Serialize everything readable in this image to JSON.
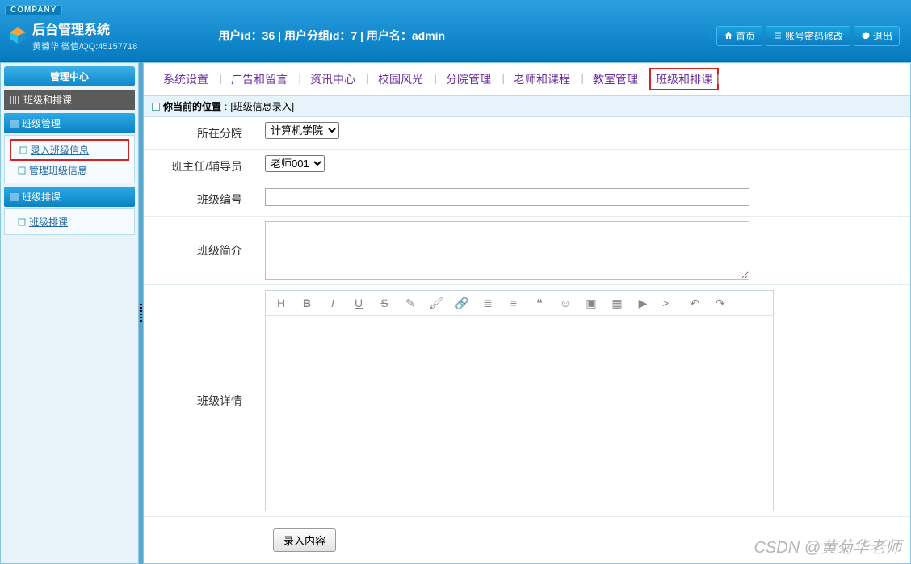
{
  "header": {
    "company_badge": "COMPANY",
    "app_title": "后台管理系统",
    "sub_title": "黄菊华 微信/QQ:45157718",
    "user_info": "用户id：36 | 用户分组id：7 | 用户名：admin",
    "btn_home": "首页",
    "btn_account": "账号密码修改",
    "btn_logout": "退出"
  },
  "left": {
    "center_header": "管理中心",
    "crumb": "班级和排课",
    "groups": [
      {
        "name": "class-mgmt",
        "title": "班级管理",
        "items": [
          {
            "name": "enter-class-info",
            "label": "录入班级信息",
            "highlight": true
          },
          {
            "name": "manage-class-info",
            "label": "管理班级信息",
            "highlight": false
          }
        ]
      },
      {
        "name": "schedule",
        "title": "班级排课",
        "items": [
          {
            "name": "class-schedule",
            "label": "班级排课",
            "highlight": false
          }
        ]
      }
    ]
  },
  "tabs": [
    {
      "name": "sys-settings",
      "label": "系统设置"
    },
    {
      "name": "ads-msg",
      "label": "广告和留言"
    },
    {
      "name": "info-center",
      "label": "资讯中心"
    },
    {
      "name": "campus-scenery",
      "label": "校园风光"
    },
    {
      "name": "branch-mgmt",
      "label": "分院管理"
    },
    {
      "name": "teacher-course",
      "label": "老师和课程"
    },
    {
      "name": "room-mgmt",
      "label": "教室管理"
    },
    {
      "name": "class-schedule-tab",
      "label": "班级和排课",
      "highlight": true
    }
  ],
  "breadcrumb": {
    "prefix": "你当前的位置",
    "location": "[班级信息录入]"
  },
  "form": {
    "branch_label": "所在分院",
    "branch_value": "计算机学院",
    "head_label": "班主任/辅导员",
    "head_value": "老师001",
    "classno_label": "班级编号",
    "classno_value": "",
    "intro_label": "班级简介",
    "intro_value": "",
    "detail_label": "班级详情",
    "detail_value": "",
    "submit_label": "录入内容"
  },
  "toolbar_icons": [
    "heading",
    "bold",
    "italic",
    "underline",
    "strike",
    "eraser",
    "brush",
    "link",
    "list-ol",
    "align",
    "quote",
    "smile",
    "image",
    "grid",
    "video",
    "code",
    "undo",
    "redo"
  ],
  "watermark": "CSDN @黄菊华老师"
}
